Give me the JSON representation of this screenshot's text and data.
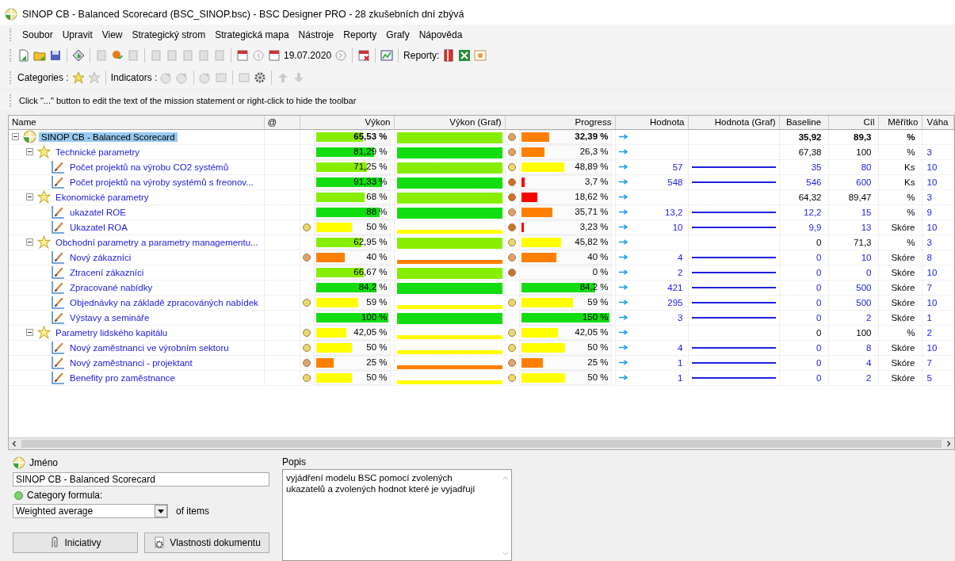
{
  "window": {
    "title": "SINOP CB - Balanced Scorecard (BSC_SINOP.bsc) - BSC Designer PRO - 28 zkušebních dní zbývá"
  },
  "menu": [
    "Soubor",
    "Upravit",
    "View",
    "Strategický strom",
    "Strategická mapa",
    "Nástroje",
    "Reporty",
    "Grafy",
    "Nápověda"
  ],
  "toolbar": {
    "date": "19.07.2020",
    "reports_label": "Reporty:"
  },
  "toolbar2": {
    "categories_label": "Categories :",
    "indicators_label": "Indicators :"
  },
  "hint": "Click \"...\" button to edit the text of the mission statement or right-click to hide the toolbar",
  "table": {
    "columns": [
      "Name",
      "@",
      "Výkon",
      "Výkon (Graf)",
      "Progress",
      "Hodnota",
      "Hodnota (Graf)",
      "Baseline",
      "Cíl",
      "Měřítko",
      "Váha"
    ],
    "rows": [
      {
        "kind": "scorecard",
        "name": "SINOP CB - Balanced Scorecard",
        "selected": true,
        "expanded": true,
        "performance": {
          "text": "65,53 %",
          "level": 0.6553,
          "color": "#88ee00"
        },
        "progress": {
          "text": "32,39 %",
          "level": 0.3239,
          "color": "#ff8000"
        },
        "progress_dot": {
          "color": "#e0a070"
        },
        "baseline": "35,92",
        "target": "89,3",
        "unit": "%",
        "children": [
          {
            "kind": "category",
            "name": "Technické parametry",
            "selected": false,
            "expanded": true,
            "performance": {
              "text": "81,29 %",
              "level": 0.8129,
              "color": "#11dd11"
            },
            "progress": {
              "text": "26,3 %",
              "level": 0.263,
              "color": "#ff8000"
            },
            "progress_dot": {
              "color": "#e0a070"
            },
            "baseline": "67,38",
            "target": "100",
            "unit": "%",
            "weight": "3",
            "children": [
              {
                "kind": "indicator",
                "name": "Počet projektů na výrobu CO2 systémů",
                "selected": false,
                "performance": {
                  "text": "71,25 %",
                  "level": 0.7125,
                  "color": "#88ee00"
                },
                "progress": {
                  "text": "48,89 %",
                  "level": 0.4889,
                  "color": "#ffff00"
                },
                "progress_dot": {
                  "color": "#e8d870"
                },
                "value": "57",
                "baseline": "35",
                "target": "80",
                "unit": "Ks",
                "weight": "10"
              },
              {
                "kind": "indicator",
                "name": "Počet projektů na výroby systémů s freonov...",
                "selected": false,
                "performance": {
                  "text": "91,33 %",
                  "level": 0.9133,
                  "color": "#11dd11"
                },
                "progress": {
                  "text": "3,7 %",
                  "level": 0.037,
                  "color": "#ff0000"
                },
                "progress_dot": {
                  "color": "#d07030"
                },
                "value": "548",
                "baseline": "546",
                "target": "600",
                "unit": "Ks",
                "weight": "10"
              }
            ]
          },
          {
            "kind": "category",
            "name": "Ekonomické parametry",
            "selected": false,
            "expanded": true,
            "performance": {
              "text": "68 %",
              "level": 0.68,
              "color": "#88ee00"
            },
            "progress": {
              "text": "18,62 %",
              "level": 0.1862,
              "color": "#ff0000"
            },
            "progress_dot": {
              "color": "#d07030"
            },
            "baseline": "64,32",
            "target": "89,47",
            "unit": "%",
            "weight": "3",
            "children": [
              {
                "kind": "indicator",
                "name": "ukazatel ROE",
                "selected": false,
                "performance": {
                  "text": "88 %",
                  "level": 0.88,
                  "color": "#11dd11"
                },
                "progress": {
                  "text": "35,71 %",
                  "level": 0.3571,
                  "color": "#ff8000"
                },
                "progress_dot": {
                  "color": "#e0a070"
                },
                "value": "13,2",
                "baseline": "12,2",
                "target": "15",
                "unit": "%",
                "weight": "9"
              },
              {
                "kind": "indicator",
                "name": "Ukazatel ROA",
                "selected": false,
                "performance": {
                  "text": "50 %",
                  "level": 0.5,
                  "color": "#ffff00"
                },
                "performance_dot": {
                  "color": "#e8d870"
                },
                "progress": {
                  "text": "3,23 %",
                  "level": 0.0323,
                  "color": "#ff0000"
                },
                "progress_dot": {
                  "color": "#d07030"
                },
                "value": "10",
                "baseline": "9,9",
                "target": "13",
                "unit": "Skóre",
                "weight": "10"
              }
            ]
          },
          {
            "kind": "category",
            "name": "Obchodní parametry a parametry managementu...",
            "selected": false,
            "expanded": true,
            "performance": {
              "text": "62,95 %",
              "level": 0.6295,
              "color": "#88ee00"
            },
            "progress": {
              "text": "45,82 %",
              "level": 0.4582,
              "color": "#ffff00"
            },
            "progress_dot": {
              "color": "#e8d870"
            },
            "baseline": "0",
            "target": "71,3",
            "unit": "%",
            "weight": "3",
            "children": [
              {
                "kind": "indicator",
                "name": "Nový zákazníci",
                "selected": false,
                "performance": {
                  "text": "40 %",
                  "level": 0.4,
                  "color": "#ff8000"
                },
                "performance_dot": {
                  "color": "#e0a070"
                },
                "progress": {
                  "text": "40 %",
                  "level": 0.4,
                  "color": "#ff8000"
                },
                "progress_dot": {
                  "color": "#e0a070"
                },
                "value": "4",
                "baseline": "0",
                "target": "10",
                "unit": "Skóre",
                "weight": "8"
              },
              {
                "kind": "indicator",
                "name": "Ztracení zákazníci",
                "selected": false,
                "performance": {
                  "text": "66,67 %",
                  "level": 0.6667,
                  "color": "#88ee00"
                },
                "progress": {
                  "text": "0 %"
                },
                "progress_dot": {
                  "color": "#d07030"
                },
                "value": "2",
                "baseline": "0",
                "target": "0",
                "unit": "Skóre",
                "weight": "10"
              },
              {
                "kind": "indicator",
                "name": "Zpracované nabídky",
                "selected": false,
                "performance": {
                  "text": "84,2 %",
                  "level": 0.842,
                  "color": "#11dd11"
                },
                "progress": {
                  "text": "84,2 %",
                  "level": 0.842,
                  "color": "#11dd11"
                },
                "value": "421",
                "baseline": "0",
                "target": "500",
                "unit": "Skóre",
                "weight": "7"
              },
              {
                "kind": "indicator",
                "name": "Objednávky na základě zpracováných nabídek",
                "selected": false,
                "performance": {
                  "text": "59 %",
                  "level": 0.59,
                  "color": "#ffff00"
                },
                "performance_dot": {
                  "color": "#e8d870"
                },
                "progress": {
                  "text": "59 %",
                  "level": 0.59,
                  "color": "#ffff00"
                },
                "progress_dot": {
                  "color": "#e8d870"
                },
                "value": "295",
                "baseline": "0",
                "target": "500",
                "unit": "Skóre",
                "weight": "10"
              },
              {
                "kind": "indicator",
                "name": "Výstavy a semináře",
                "selected": false,
                "performance": {
                  "text": "100 %",
                  "level": 1,
                  "color": "#11dd11"
                },
                "progress": {
                  "text": "150 %",
                  "level": 1,
                  "color": "#11dd11"
                },
                "value": "3",
                "baseline": "0",
                "target": "2",
                "unit": "Skóre",
                "weight": "1"
              }
            ]
          },
          {
            "kind": "category",
            "name": "Parametry lidského kapitálu",
            "selected": false,
            "expanded": true,
            "performance": {
              "text": "42,05 %",
              "level": 0.4205,
              "color": "#ffff00"
            },
            "performance_dot": {
              "color": "#e8d870"
            },
            "progress": {
              "text": "42,05 %",
              "level": 0.4205,
              "color": "#ffff00"
            },
            "progress_dot": {
              "color": "#e8d870"
            },
            "baseline": "0",
            "target": "100",
            "unit": "%",
            "weight": "2",
            "children": [
              {
                "kind": "indicator",
                "name": "Nový zaměstnanci ve výrobním sektoru",
                "selected": false,
                "performance": {
                  "text": "50 %",
                  "level": 0.5,
                  "color": "#ffff00"
                },
                "performance_dot": {
                  "color": "#e8d870"
                },
                "progress": {
                  "text": "50 %",
                  "level": 0.5,
                  "color": "#ffff00"
                },
                "progress_dot": {
                  "color": "#e8d870"
                },
                "value": "4",
                "baseline": "0",
                "target": "8",
                "unit": "Skóre",
                "weight": "10"
              },
              {
                "kind": "indicator",
                "name": "Nový zaměstnanci - projektant",
                "selected": false,
                "performance": {
                  "text": "25 %",
                  "level": 0.25,
                  "color": "#ff8000"
                },
                "performance_dot": {
                  "color": "#e0a070"
                },
                "progress": {
                  "text": "25 %",
                  "level": 0.25,
                  "color": "#ff8000"
                },
                "progress_dot": {
                  "color": "#e0a070"
                },
                "value": "1",
                "baseline": "0",
                "target": "4",
                "unit": "Skóre",
                "weight": "7"
              },
              {
                "kind": "indicator",
                "name": "Benefity pro zaměstnance",
                "selected": false,
                "performance": {
                  "text": "50 %",
                  "level": 0.5,
                  "color": "#ffff00"
                },
                "performance_dot": {
                  "color": "#e8d870"
                },
                "progress": {
                  "text": "50 %",
                  "level": 0.5,
                  "color": "#ffff00"
                },
                "progress_dot": {
                  "color": "#e8d870"
                },
                "value": "1",
                "baseline": "0",
                "target": "2",
                "unit": "Skóre",
                "weight": "5"
              }
            ]
          }
        ]
      }
    ]
  },
  "details": {
    "name_label": "Jméno",
    "name_value": "SINOP CB - Balanced Scorecard",
    "formula_label": "Category formula:",
    "formula_value": "Weighted average",
    "formula_suffix": "of items",
    "buttons": [
      "Iniciativy",
      "Vlastnosti dokumentu"
    ],
    "description_label": "Popis",
    "description_value": "vyjádření modelu BSC pomocí zvolených ukazatelů a zvolených hodnot které je vyjadřují"
  }
}
